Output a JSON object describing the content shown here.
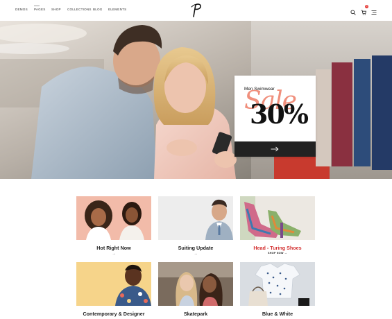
{
  "nav": {
    "items": [
      "DEMOS",
      "PAGES",
      "SHOP",
      "COLLECTIONS",
      "BLOG",
      "ELEMENTS"
    ]
  },
  "logo": {
    "letter": "P"
  },
  "header_icons": {
    "search": "search-icon",
    "cart": "cart-icon",
    "cart_count": "0",
    "menu": "menu-icon"
  },
  "promo": {
    "title": "Men Swimwear",
    "script": "Sale",
    "big": "30%",
    "arrow": "arrow-right-icon"
  },
  "categories": [
    {
      "label": "Hot Right Now",
      "link": "→"
    },
    {
      "label": "Suiting Update",
      "link": "→"
    },
    {
      "label": "Head - Turing Shoes",
      "link": "SHOP NOW →"
    },
    {
      "label": "Contemporary & Designer"
    },
    {
      "label": "Skatepark"
    },
    {
      "label": "Blue & White"
    }
  ],
  "colors": {
    "accent": "#d32f2f",
    "promo_script": "#f08a76",
    "promo_button": "#222222"
  }
}
